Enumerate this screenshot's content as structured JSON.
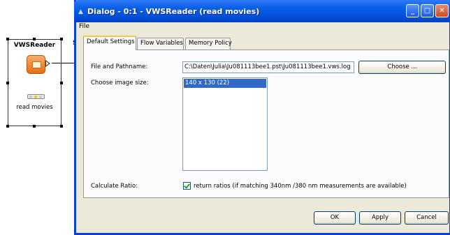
{
  "node": {
    "name": "VWSReader",
    "label": "read movies",
    "side_letter": "S"
  },
  "dialog": {
    "title": "Dialog - 0:1 - VWSReader (read movies)",
    "menu": [
      "File"
    ],
    "tabs": [
      {
        "label": "Default Settings",
        "active": true
      },
      {
        "label": "Flow Variables",
        "active": false
      },
      {
        "label": "Memory Policy",
        "active": false
      }
    ],
    "file_label": "File and Pathname:",
    "file_path": "C:\\Daten\\Julia\\Ju081113bee1.pst\\Ju081113bee1.vws.log",
    "choose_button": "Choose ...",
    "image_size_label": "Choose image size:",
    "image_sizes": [
      "140 x 130 (22)"
    ],
    "selected_image_size": "140 x 130 (22)",
    "ratio_label": "Calculate Ratio:",
    "ratio_checkbox": {
      "label": "return ratios (if matching 340nm /380 nm measurements are available)",
      "checked": true
    },
    "buttons": {
      "ok": "OK",
      "apply": "Apply",
      "cancel": "Cancel"
    }
  },
  "colors": {
    "titlebar": "#0451dc",
    "window_bg": "#ece9d8",
    "selection": "#316ac5",
    "node_icon": "#e36f14",
    "active_tab_accent": "#ffc83c"
  }
}
